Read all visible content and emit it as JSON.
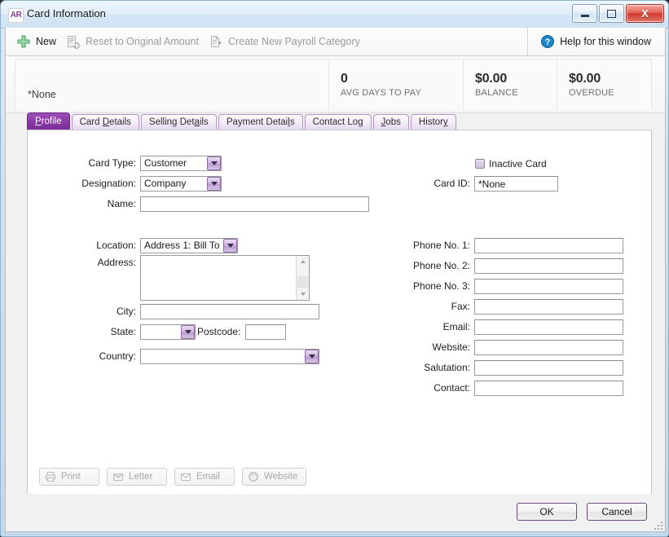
{
  "window": {
    "app_badge": "AR",
    "title": "Card Information",
    "minimize_label": "Minimize",
    "maximize_label": "Maximize",
    "close_label": "X"
  },
  "toolbar": {
    "items": [
      {
        "label": "New",
        "icon": "plus-icon",
        "enabled": true
      },
      {
        "label": "Reset to Original Amount",
        "icon": "reset-amount-icon",
        "enabled": false
      },
      {
        "label": "Create New Payroll Category",
        "icon": "new-document-icon",
        "enabled": false
      }
    ],
    "help": {
      "label": "Help for this window",
      "icon": "help-icon"
    }
  },
  "header": {
    "card_name": "*None",
    "stats": [
      {
        "value": "0",
        "label": "AVG DAYS TO PAY"
      },
      {
        "value": "$0.00",
        "label": "BALANCE"
      },
      {
        "value": "$0.00",
        "label": "OVERDUE"
      }
    ]
  },
  "tabs": [
    {
      "label": "Profile",
      "accesskey": "P",
      "active": true
    },
    {
      "label": "Card Details",
      "accesskey": "D",
      "active": false
    },
    {
      "label": "Selling Details",
      "accesskey": "a",
      "active": false
    },
    {
      "label": "Payment Details",
      "accesskey": "l",
      "active": false
    },
    {
      "label": "Contact Log",
      "accesskey": "g",
      "active": false
    },
    {
      "label": "Jobs",
      "accesskey": "J",
      "active": false
    },
    {
      "label": "History",
      "accesskey": "y",
      "active": false
    }
  ],
  "profile": {
    "card_type": {
      "label": "Card Type:",
      "value": "Customer"
    },
    "designation": {
      "label": "Designation:",
      "value": "Company"
    },
    "name": {
      "label": "Name:",
      "value": "",
      "placeholder": ""
    },
    "location": {
      "label": "Location:",
      "value": "Address 1: Bill To"
    },
    "address": {
      "label": "Address:",
      "value": "",
      "placeholder": ""
    },
    "city": {
      "label": "City:",
      "value": "",
      "placeholder": ""
    },
    "state": {
      "label": "State:",
      "value": ""
    },
    "postcode": {
      "label": "Postcode:",
      "value": "",
      "placeholder": ""
    },
    "country": {
      "label": "Country:",
      "value": ""
    },
    "inactive_card": {
      "label": "Inactive Card",
      "checked": false
    },
    "card_id": {
      "label": "Card ID:",
      "value": "*None"
    },
    "phone1": {
      "label": "Phone No. 1:",
      "value": ""
    },
    "phone2": {
      "label": "Phone No. 2:",
      "value": ""
    },
    "phone3": {
      "label": "Phone No. 3:",
      "value": ""
    },
    "fax": {
      "label": "Fax:",
      "value": ""
    },
    "email": {
      "label": "Email:",
      "value": ""
    },
    "website": {
      "label": "Website:",
      "value": ""
    },
    "salutation": {
      "label": "Salutation:",
      "value": ""
    },
    "contact": {
      "label": "Contact:",
      "value": ""
    }
  },
  "action_buttons": [
    {
      "label": "Print",
      "icon": "printer-icon",
      "enabled": false
    },
    {
      "label": "Letter",
      "icon": "letter-icon",
      "enabled": false
    },
    {
      "label": "Email",
      "icon": "envelope-icon",
      "enabled": false
    },
    {
      "label": "Website",
      "icon": "globe-icon",
      "enabled": false
    }
  ],
  "footer": {
    "ok_label": "OK",
    "cancel_label": "Cancel"
  },
  "colors": {
    "accent_purple": "#8a37a6",
    "tab_border": "#b98fcc",
    "window_border": "#8fb3cf",
    "close_red": "#cf3b2e",
    "help_blue": "#1b86c8",
    "new_green": "#3fa45b"
  }
}
